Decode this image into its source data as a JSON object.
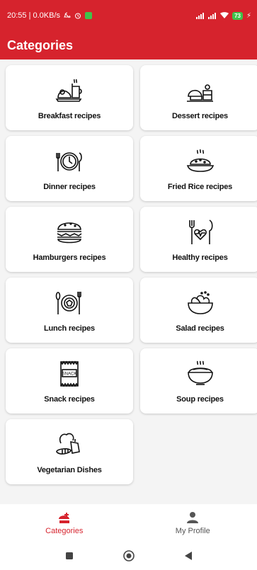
{
  "status_bar": {
    "time_net": "20:55 | 0.0KB/s",
    "battery": "73",
    "signal_icons": [
      "alarm-off-icon",
      "alarm-icon",
      "app-notification-icon",
      "signal-icon",
      "signal-icon",
      "wifi-icon",
      "battery-icon",
      "charging-icon"
    ]
  },
  "app_bar": {
    "title": "Categories"
  },
  "categories": [
    {
      "label": "Breakfast recipes",
      "icon": "breakfast-icon"
    },
    {
      "label": "Dessert recipes",
      "icon": "dessert-icon"
    },
    {
      "label": "Dinner recipes",
      "icon": "dinner-clock-icon"
    },
    {
      "label": "Fried Rice recipes",
      "icon": "fried-rice-icon"
    },
    {
      "label": "Hamburgers recipes",
      "icon": "hamburger-icon"
    },
    {
      "label": "Healthy recipes",
      "icon": "healthy-icon"
    },
    {
      "label": "Lunch recipes",
      "icon": "lunch-plate-icon"
    },
    {
      "label": "Salad recipes",
      "icon": "salad-icon"
    },
    {
      "label": "Snack recipes",
      "icon": "snack-bag-icon",
      "icon_text": "SNACK"
    },
    {
      "label": "Soup recipes",
      "icon": "soup-bowl-icon"
    },
    {
      "label": "Vegetarian Dishes",
      "icon": "vegetables-icon"
    }
  ],
  "bottom_nav": {
    "items": [
      {
        "label": "Categories",
        "icon": "categories-icon",
        "active": true
      },
      {
        "label": "My Profile",
        "icon": "profile-icon",
        "active": false
      }
    ]
  },
  "system_nav": [
    "recent-apps-icon",
    "home-icon",
    "back-icon"
  ],
  "colors": {
    "primary": "#d6232d",
    "battery": "#3fc24b",
    "card": "#ffffff",
    "background": "#f4f4f4"
  }
}
